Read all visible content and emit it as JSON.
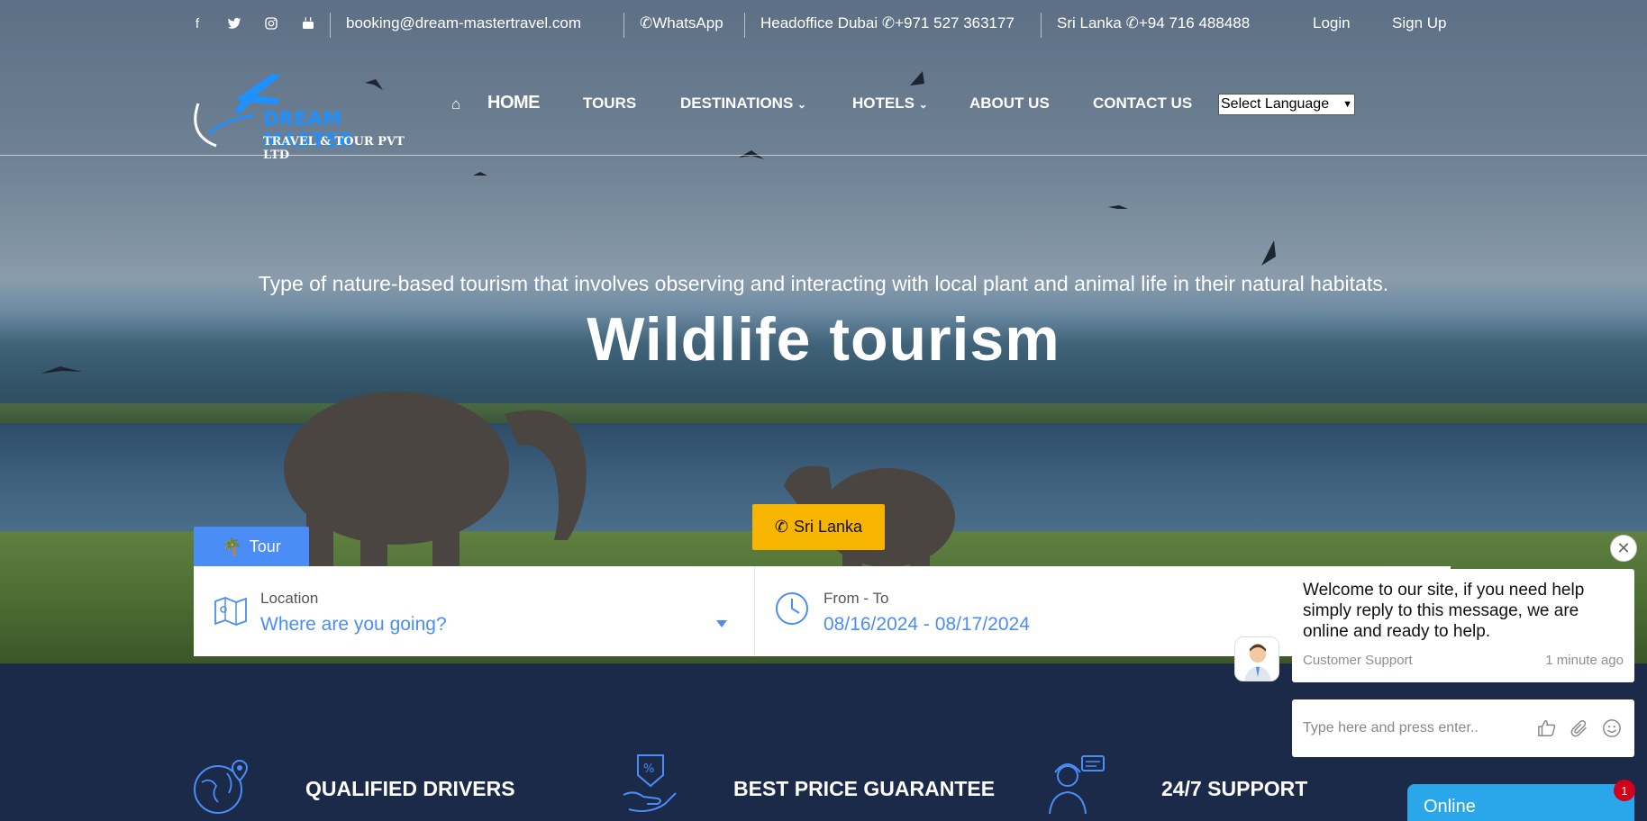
{
  "topbar": {
    "social_icons": [
      "facebook-icon",
      "twitter-icon",
      "instagram-icon",
      "youtube-icon"
    ],
    "email": "booking@dream-mastertravel.com",
    "whatsapp": "WhatsApp",
    "dubai_label": "Headoffice Dubai",
    "dubai_phone": "+971 527 363177",
    "srilanka_label": "Sri Lanka",
    "srilanka_phone": "+94 716 488488",
    "login": "Login",
    "signup": "Sign Up"
  },
  "logo": {
    "brand": "DREAM MASTER",
    "sub": "TRAVEL & TOUR PVT LTD"
  },
  "nav": {
    "home": "HOME",
    "tours": "TOURS",
    "destinations": "DESTINATIONS",
    "hotels": "HOTELS",
    "about": "ABOUT US",
    "contact": "CONTACT US",
    "language": "Select Language"
  },
  "hero": {
    "subtitle": "Type of nature-based tourism that involves observing and interacting with local plant and animal life in their natural habitats.",
    "title": "Wildlife tourism",
    "cta": "Sri Lanka"
  },
  "search": {
    "tab": "Tour",
    "location_label": "Location",
    "location_value": "Where are you going?",
    "date_label": "From - To",
    "date_value": "08/16/2024 - 08/17/2024"
  },
  "features": [
    {
      "title": "QUALIFIED DRIVERS",
      "icon": "globe-pin-icon"
    },
    {
      "title": "BEST PRICE GUARANTEE",
      "icon": "price-tag-hand-icon"
    },
    {
      "title": "24/7 SUPPORT",
      "icon": "support-agent-icon"
    }
  ],
  "chat": {
    "message": "Welcome to our site, if you need help simply reply to this message, we are online and ready to help.",
    "author": "Customer Support",
    "time": "1 minute ago",
    "input_placeholder": "Type here and press enter..",
    "online": "Online",
    "badge": "1"
  },
  "colors": {
    "accent_blue": "#4a8df6",
    "cta_yellow": "#f7b500",
    "navy": "#1c2a4a",
    "chat_blue": "#2aa7ea"
  }
}
